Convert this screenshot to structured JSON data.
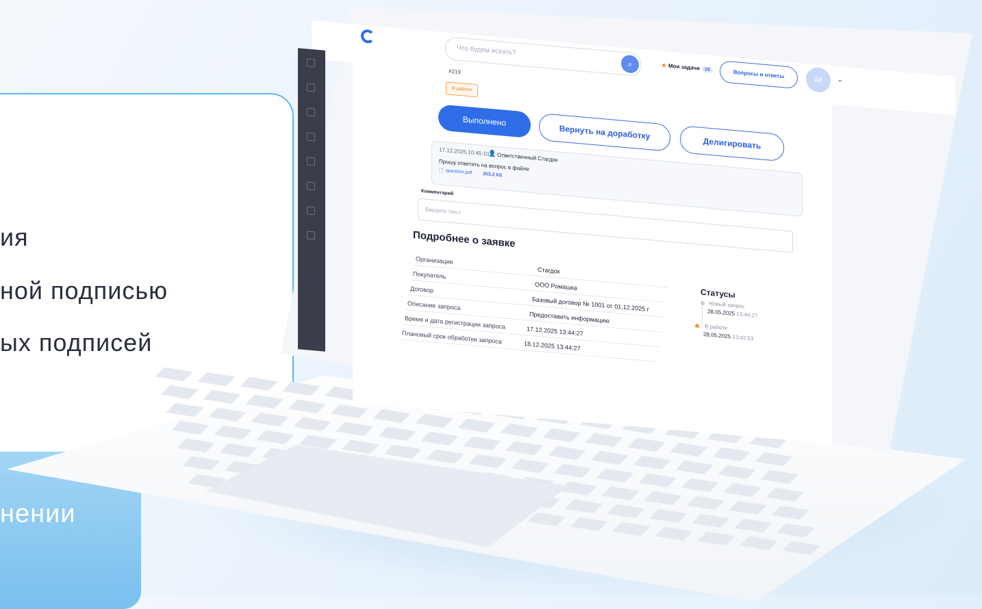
{
  "promo": {
    "lines": [
      "ия",
      "ной подписью",
      "ых подписей"
    ],
    "bottom_text": "нении"
  },
  "app": {
    "search_placeholder": "Что будем искать?",
    "my_tasks_label": "Мои задачи",
    "my_tasks_count": "19",
    "qa_button": "Вопросы и ответы",
    "avatar_initials": "АВ"
  },
  "request": {
    "id": "#219",
    "status": "В работе",
    "actions": {
      "done": "Выполнено",
      "return": "Вернуть на доработку",
      "delegate": "Делигировать"
    },
    "comment": {
      "timestamp": "17.12.2025 10:45:10",
      "author": "Ответственный Стагдок",
      "text": "Прошу ответить на вопрос в файле",
      "file_name": "question.pdf",
      "file_size": "203.2 Кб"
    },
    "comment_label": "Комментарий",
    "comment_placeholder": "Введите текст"
  },
  "details": {
    "title": "Подробнее о заявке",
    "rows": [
      {
        "label": "Организация",
        "value": "Стагдок"
      },
      {
        "label": "Покупатель",
        "value": "ООО Ромашка"
      },
      {
        "label": "Договор",
        "value": "Базовый договор № 1001 от 01.12.2025 г"
      },
      {
        "label": "Описание запроса",
        "value": "Предоставить информацию"
      },
      {
        "label": "Время и дата регистрации запроса",
        "value": "17.12.2025 13:44:27"
      },
      {
        "label": "Плановый срок обработки запроса",
        "value": "18.12.2025 13:44:27"
      }
    ]
  },
  "statuses": {
    "title": "Статусы",
    "items": [
      {
        "name": "Новый запрос",
        "date": "28.05.2025",
        "time": "13:44:27",
        "color": "#c9ced8"
      },
      {
        "name": "В работе",
        "date": "28.05.2025",
        "time": "13:42:53",
        "color": "#f39c3c"
      }
    ]
  }
}
